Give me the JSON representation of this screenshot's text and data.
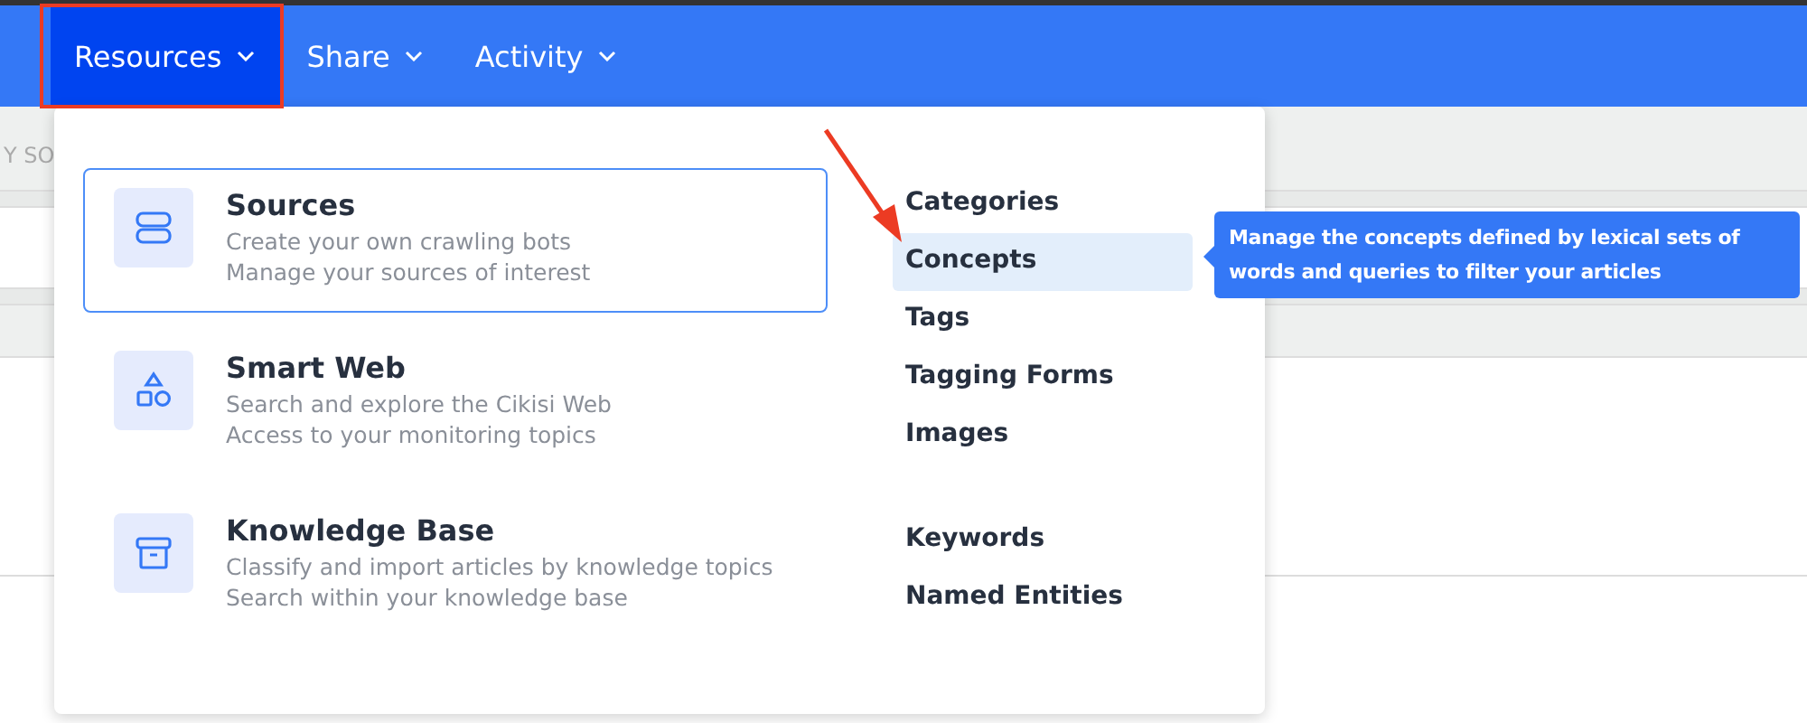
{
  "nav": [
    {
      "label": "Resources",
      "selected": true
    },
    {
      "label": "Share",
      "selected": false
    },
    {
      "label": "Activity",
      "selected": false
    }
  ],
  "background": {
    "column_text": "Y SO"
  },
  "menu": {
    "cards": [
      {
        "kind": "server",
        "title": "Sources",
        "lines": [
          "Create your own crawling bots",
          "Manage your sources of interest"
        ],
        "selected": true
      },
      {
        "kind": "shapes",
        "title": "Smart Web",
        "lines": [
          "Search and explore the Cikisi Web",
          "Access to your monitoring topics"
        ],
        "selected": false
      },
      {
        "kind": "archive",
        "title": "Knowledge Base",
        "lines": [
          "Classify and import articles by knowledge topics",
          "Search within your knowledge base"
        ],
        "selected": false
      }
    ],
    "link_groups": [
      {
        "items": [
          {
            "label": "Categories",
            "selected": false
          },
          {
            "label": "Concepts",
            "selected": true
          },
          {
            "label": "Tags",
            "selected": false
          },
          {
            "label": "Tagging Forms",
            "selected": false
          },
          {
            "label": "Images",
            "selected": false
          }
        ]
      },
      {
        "items": [
          {
            "label": "Keywords",
            "selected": false
          },
          {
            "label": "Named Entities",
            "selected": false
          }
        ]
      }
    ]
  },
  "tooltip": {
    "text": "Manage the concepts defined by lexical sets of words and queries to filter your articles"
  }
}
